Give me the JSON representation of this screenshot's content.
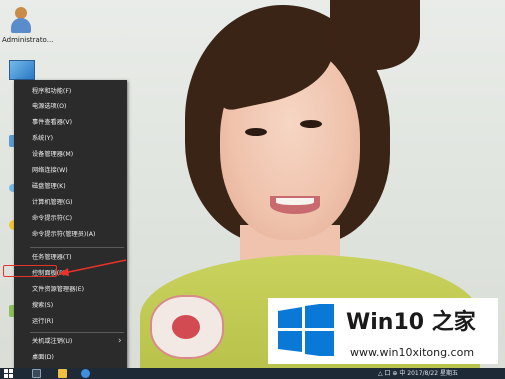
{
  "desktop": {
    "user_icon_label": "Administrato..."
  },
  "context_menu": {
    "items": [
      {
        "label": "程序和功能(F)"
      },
      {
        "label": "电源选项(O)"
      },
      {
        "label": "事件查看器(V)"
      },
      {
        "label": "系统(Y)"
      },
      {
        "label": "设备管理器(M)"
      },
      {
        "label": "网络连接(W)"
      },
      {
        "label": "磁盘管理(K)"
      },
      {
        "label": "计算机管理(G)"
      },
      {
        "label": "命令提示符(C)"
      },
      {
        "label": "命令提示符(管理员)(A)"
      },
      {
        "label": "任务管理器(T)"
      },
      {
        "label": "控制面板(P)"
      },
      {
        "label": "文件资源管理器(E)"
      },
      {
        "label": "搜索(S)"
      },
      {
        "label": "运行(R)"
      },
      {
        "label": "关机或注销(U)"
      },
      {
        "label": "桌面(D)"
      }
    ],
    "submenu_arrow": "›",
    "highlighted_item": "控制面板(P)"
  },
  "watermark": {
    "title": "Win10 之家",
    "url": "www.win10xitong.com"
  },
  "taskbar": {
    "tray_text": "△ 口 ⊕ 中  2017/8/22  星期五"
  },
  "colors": {
    "menu_bg": "#2b2b2b",
    "menu_text": "#f2f2f2",
    "highlight": "#e8322a",
    "win_blue": "#0a78d7",
    "taskbar": "#1e2a36"
  }
}
